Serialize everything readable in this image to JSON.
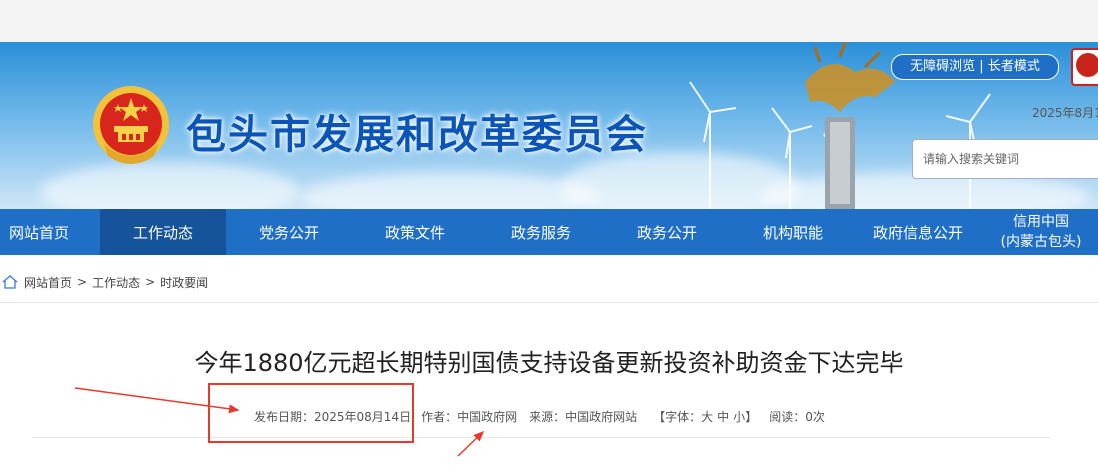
{
  "header": {
    "site_title": "包头市发展和改革委员会",
    "accessibility": "无障碍浏览 | 长者模式",
    "date": "2025年8月1",
    "search": {
      "placeholder": "请输入搜索关键词"
    }
  },
  "nav": {
    "items": [
      {
        "label": "网站首页"
      },
      {
        "label": "工作动态",
        "active": true
      },
      {
        "label": "党务公开"
      },
      {
        "label": "政策文件"
      },
      {
        "label": "政务服务"
      },
      {
        "label": "政务公开"
      },
      {
        "label": "机构职能"
      },
      {
        "label": "政府信息公开"
      },
      {
        "label_line1": "信用中国",
        "label_line2": "(内蒙古包头)"
      }
    ]
  },
  "breadcrumb": {
    "items": [
      "网站首页",
      "工作动态",
      "时政要闻"
    ],
    "separator": ">"
  },
  "article": {
    "title": "今年1880亿元超长期特别国债支持设备更新投资补助资金下达完毕",
    "meta": {
      "publish_date": "发布日期：2025年08月14日",
      "author": "作者：中国政府网",
      "source": "来源：中国政府网站",
      "font_prefix": "【字体：",
      "font_large": "大",
      "font_medium": "中",
      "font_small": "小",
      "font_suffix": "】",
      "reads": "阅读：0次"
    }
  },
  "colors": {
    "nav": "#1f6fc7",
    "nav_active": "#15539a",
    "title": "#0b55b8",
    "annotation": "#e63a2e"
  }
}
